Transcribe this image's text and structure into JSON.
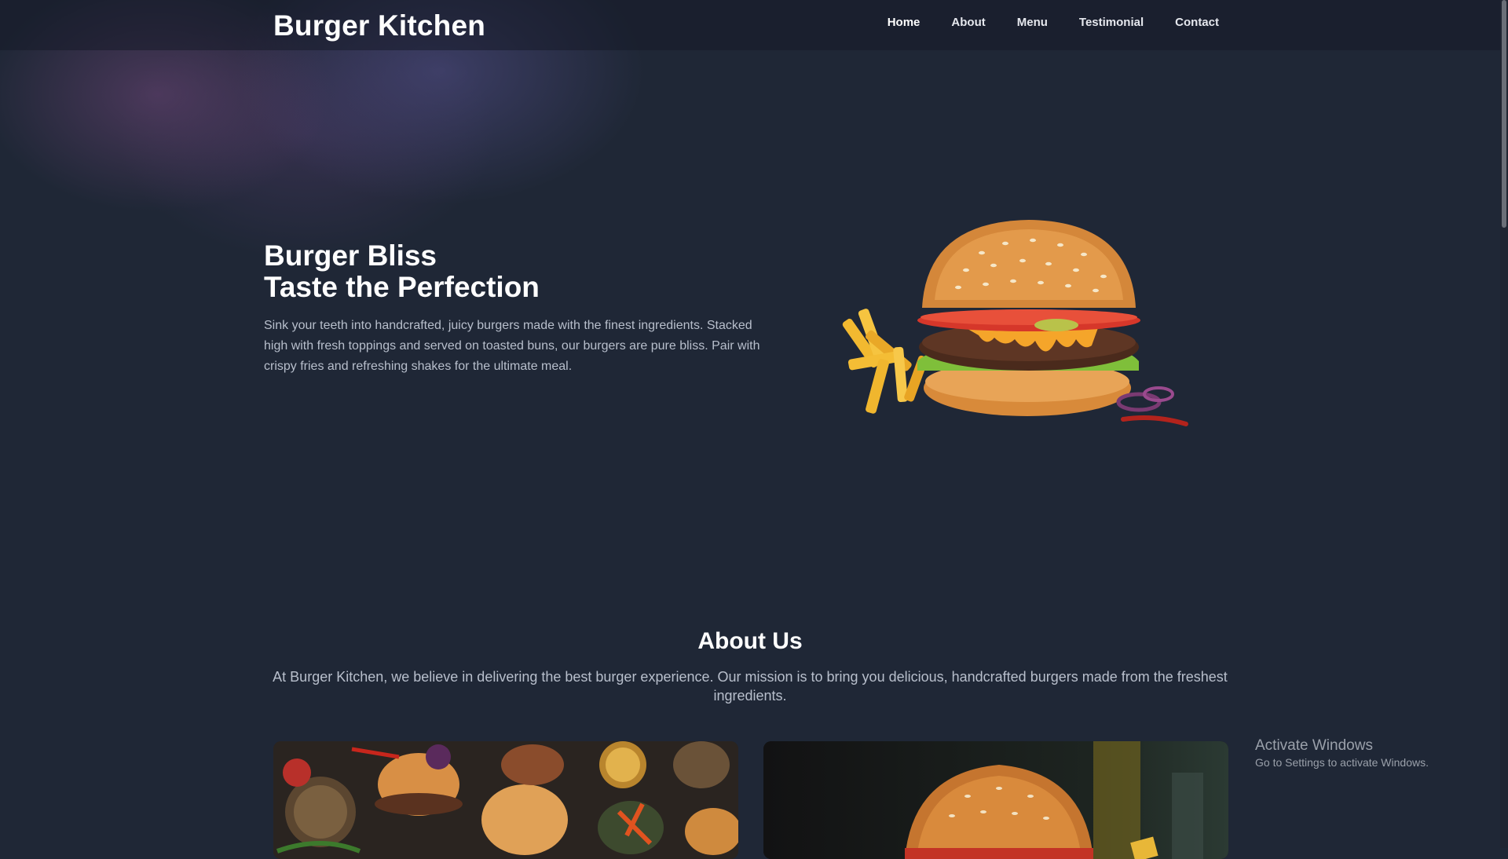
{
  "nav": {
    "brand": "Burger Kitchen",
    "links": [
      {
        "label": "Home",
        "active": true
      },
      {
        "label": "About",
        "active": false
      },
      {
        "label": "Menu",
        "active": false
      },
      {
        "label": "Testimonial",
        "active": false
      },
      {
        "label": "Contact",
        "active": false
      }
    ]
  },
  "hero": {
    "title_line1": "Burger Bliss",
    "title_line2": "Taste the Perfection",
    "description": "Sink your teeth into handcrafted, juicy burgers made with the finest ingredients. Stacked high with fresh toppings and served on toasted buns, our burgers are pure bliss. Pair with crispy fries and refreshing shakes for the ultimate meal.",
    "image_icon": "burger-with-fries-image"
  },
  "about": {
    "title": "About Us",
    "description": "At Burger Kitchen, we believe in delivering the best burger experience. Our mission is to bring you delicious, handcrafted burgers made from the freshest ingredients.",
    "cards": [
      {
        "image_icon": "burgers-spread-image"
      },
      {
        "image_icon": "burger-closeup-image"
      }
    ]
  },
  "overlay": {
    "title": "Activate Windows",
    "subtitle": "Go to Settings to activate Windows."
  },
  "colors": {
    "background": "#1f2736",
    "text_muted": "#b8bfcc"
  }
}
